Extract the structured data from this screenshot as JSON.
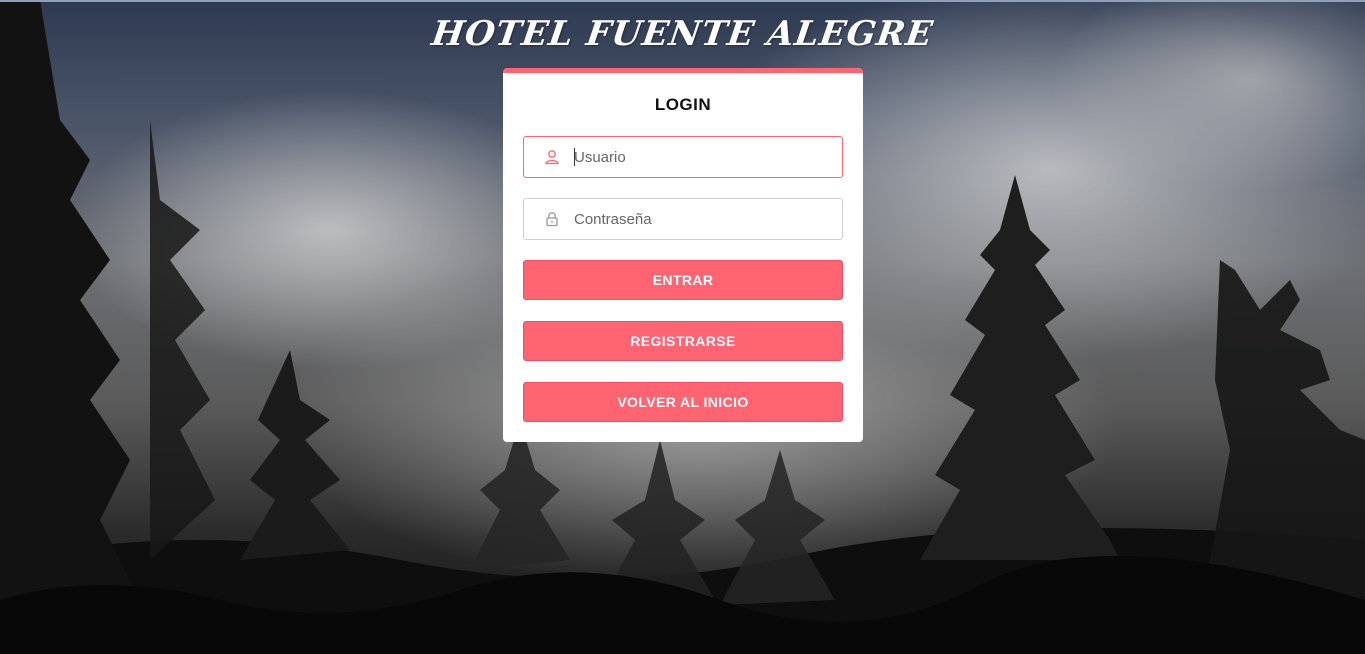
{
  "header": {
    "title": "HOTEL FUENTE ALEGRE"
  },
  "login": {
    "title": "LOGIN",
    "username": {
      "placeholder": "Usuario",
      "value": "",
      "icon": "user-icon"
    },
    "password": {
      "placeholder": "Contraseña",
      "value": "",
      "icon": "lock-icon"
    },
    "buttons": {
      "enter": "ENTRAR",
      "register": "REGISTRARSE",
      "back_home": "VOLVER AL INICIO"
    }
  },
  "colors": {
    "accent": "#ff6470",
    "card_background": "#ffffff",
    "title_text": "#ffffff"
  }
}
